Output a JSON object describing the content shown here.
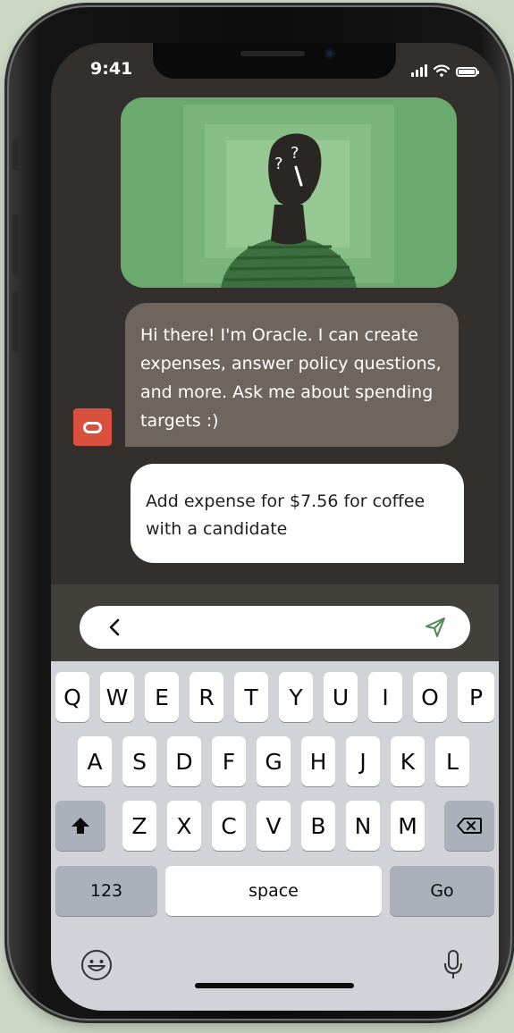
{
  "status_bar": {
    "time": "9:41"
  },
  "chat": {
    "bot_message": "Hi there! I'm Oracle. I can create expenses, answer policy questions, and more. Ask me about spending targets :)",
    "user_message": "Add expense for $7.56 for coffee with a candidate"
  },
  "keyboard": {
    "row1": [
      "Q",
      "W",
      "E",
      "R",
      "T",
      "Y",
      "U",
      "I",
      "O",
      "P"
    ],
    "row2": [
      "A",
      "S",
      "D",
      "F",
      "G",
      "H",
      "J",
      "K",
      "L"
    ],
    "row3": [
      "Z",
      "X",
      "C",
      "V",
      "B",
      "N",
      "M"
    ],
    "numbers_label": "123",
    "space_label": "space",
    "go_label": "Go"
  },
  "colors": {
    "screen_bg": "#322f2c",
    "bot_bubble": "#6e655e",
    "user_bubble": "#ffffff",
    "avatar": "#d9503e",
    "illustration_bg": "#6aaa6f",
    "send_icon": "#4e8a55"
  },
  "icons": {
    "bot_avatar": "oracle-logo-icon",
    "back": "chevron-left-icon",
    "send": "paper-plane-icon",
    "shift": "shift-arrow-icon",
    "delete": "backspace-icon",
    "emoji": "emoji-icon",
    "mic": "microphone-icon"
  }
}
